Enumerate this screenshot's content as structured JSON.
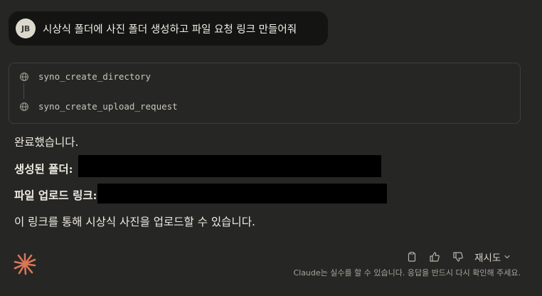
{
  "user": {
    "avatar_initials": "JB",
    "message": "시상식 폴더에 사진 폴더 생성하고 파일 요청 링크 만들어줘"
  },
  "tools": [
    {
      "name": "syno_create_directory",
      "icon": "globe-icon"
    },
    {
      "name": "syno_create_upload_request",
      "icon": "globe-icon"
    }
  ],
  "response": {
    "line1": "완료했습니다.",
    "folder_label": "생성된 폴더:",
    "link_label": "파일 업로드 링크:",
    "line4": "이 링크를 통해 시상식 사진을 업로드할 수 있습니다."
  },
  "footer": {
    "retry_label": "재시도",
    "disclaimer": "Claude는 실수를 할 수 있습니다. 응답을 반드시 다시 확인해 주세요.",
    "icons": [
      "copy-icon",
      "thumbs-up-icon",
      "thumbs-down-icon",
      "chevron-down-icon"
    ],
    "logo": "claude-logo"
  },
  "colors": {
    "background": "#262624",
    "bubble": "#141413",
    "accent": "#d97757",
    "text": "#e9e6dc"
  }
}
